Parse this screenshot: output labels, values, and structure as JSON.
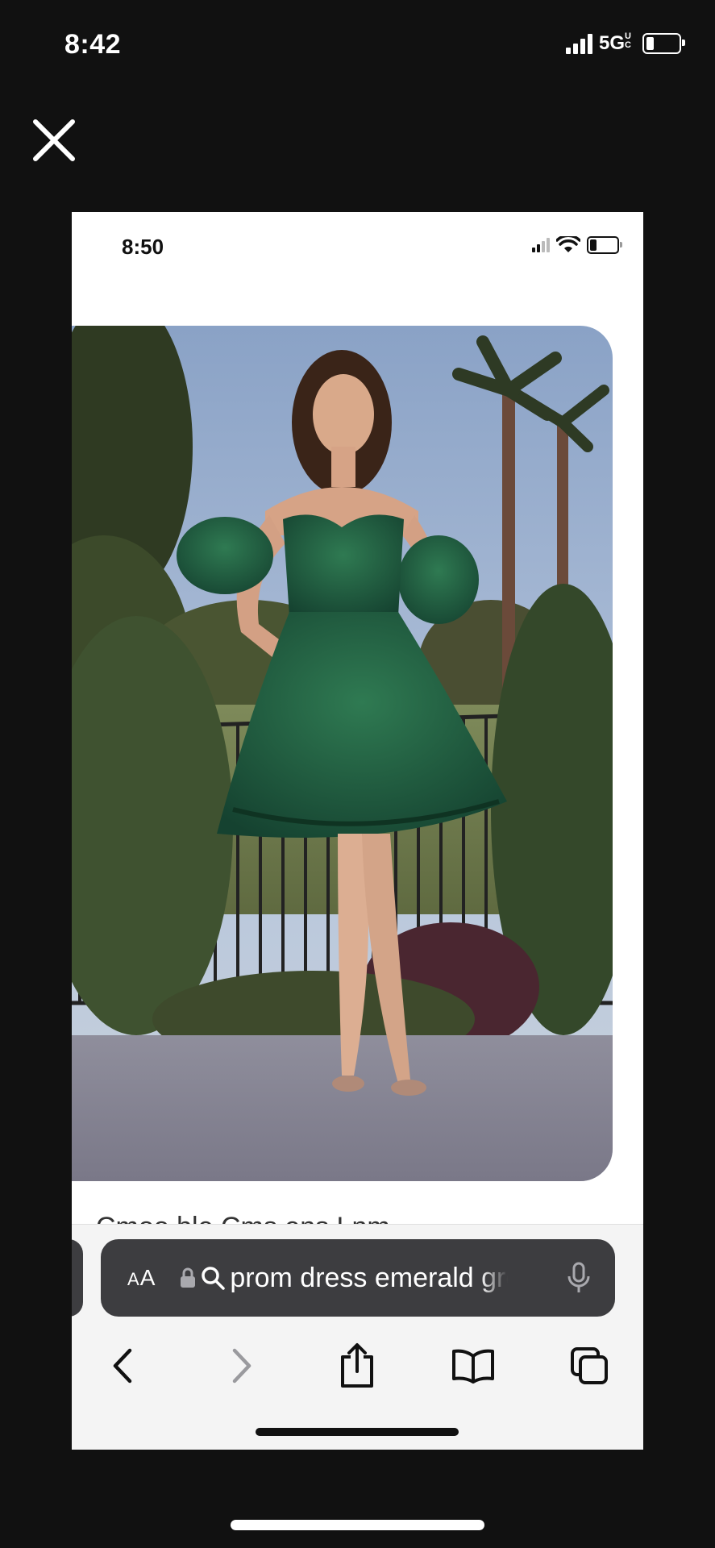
{
  "outer_status": {
    "time": "8:42",
    "network": "5G",
    "network_suffix": "UC",
    "battery_percent": 25
  },
  "inner_status": {
    "time": "8:50",
    "battery_percent": 30
  },
  "search": {
    "text_size_label": "AA",
    "query": "prom dress emerald green"
  },
  "product": {
    "title_partial": "Cmoo ble Cms ens Lnm ...",
    "tag_icon": "price-tag-icon"
  },
  "toolbar": {
    "icons": [
      "back-icon",
      "forward-icon",
      "share-icon",
      "bookmarks-icon",
      "tabs-icon"
    ]
  },
  "colors": {
    "dress": "#1f5a3c",
    "urlbar": "#3d3d40",
    "frame_bg": "#111111"
  }
}
